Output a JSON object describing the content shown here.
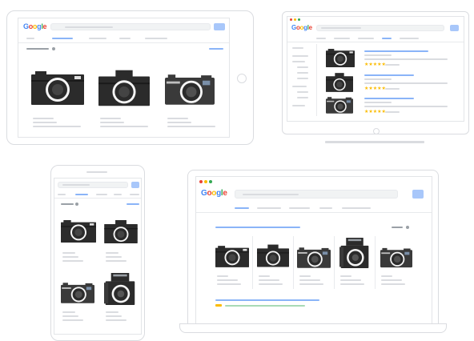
{
  "brand": {
    "logo_text": "Google",
    "colors": {
      "blue": "#4285f4",
      "red": "#ea4335",
      "yellow": "#fbbc05",
      "green": "#34a853",
      "frame": "#dadce0",
      "accent_bar": "#8ab4f8"
    }
  },
  "devices": {
    "tablet": {
      "logo": "Google",
      "result_count": 3
    },
    "desktop": {
      "logo": "Google",
      "result_count": 3,
      "rating_stars": "★★★★★"
    },
    "phone": {
      "result_count": 4
    },
    "laptop": {
      "logo": "Google",
      "result_count": 5
    }
  },
  "icons": [
    "camera-icon",
    "search-button",
    "home-button",
    "window-dots"
  ]
}
